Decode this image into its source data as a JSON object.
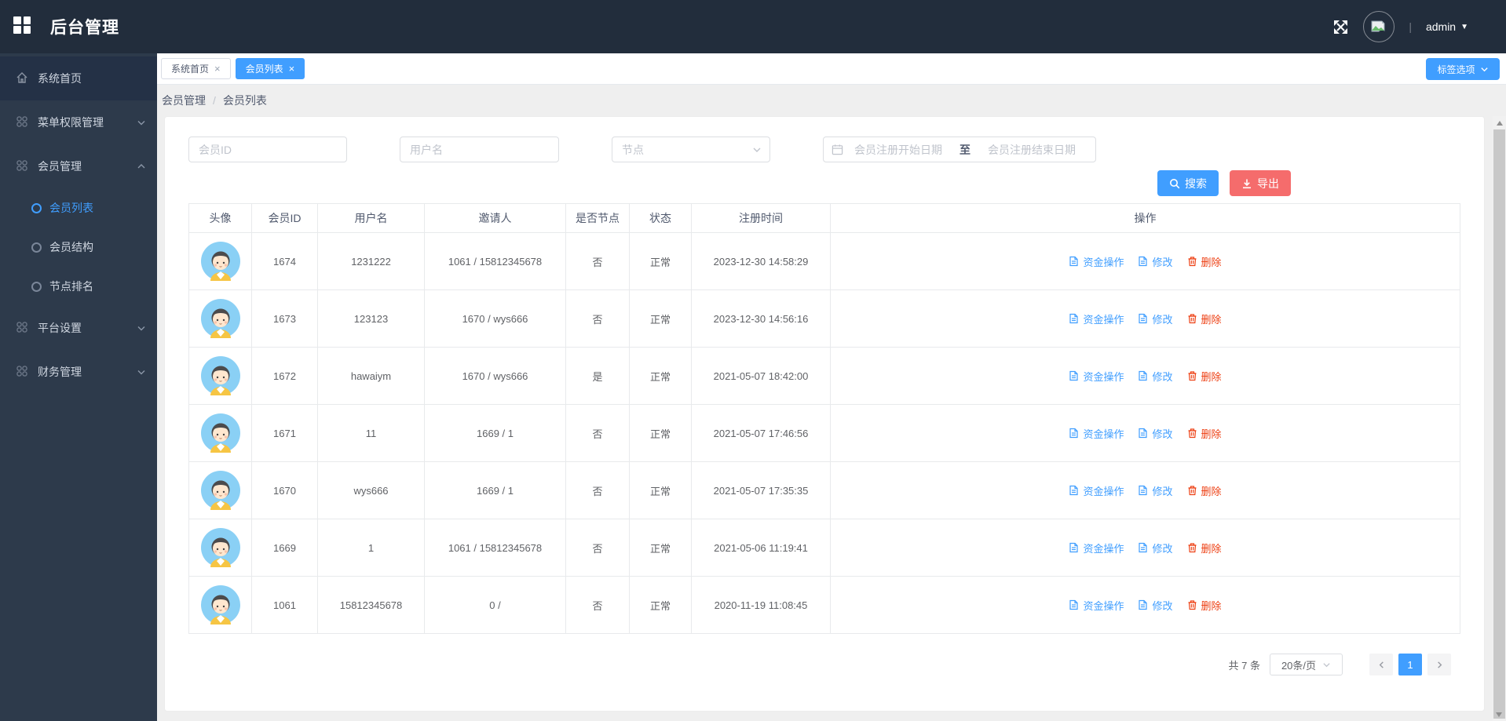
{
  "app": {
    "title": "后台管理",
    "user": "admin"
  },
  "sidebar": {
    "items": [
      {
        "label": "系统首页"
      },
      {
        "label": "菜单权限管理"
      },
      {
        "label": "会员管理"
      },
      {
        "label": "会员列表"
      },
      {
        "label": "会员结构"
      },
      {
        "label": "节点排名"
      },
      {
        "label": "平台设置"
      },
      {
        "label": "财务管理"
      }
    ]
  },
  "tabs": [
    {
      "label": "系统首页"
    },
    {
      "label": "会员列表"
    }
  ],
  "tab_options_label": "标签选项",
  "breadcrumb": {
    "parent": "会员管理",
    "sep": "/",
    "current": "会员列表"
  },
  "filters": {
    "member_id_placeholder": "会员ID",
    "username_placeholder": "用户名",
    "node_placeholder": "节点",
    "date_start_placeholder": "会员注册开始日期",
    "date_to": "至",
    "date_end_placeholder": "会员注册结束日期",
    "search_label": "搜索",
    "export_label": "导出"
  },
  "table": {
    "headers": [
      "头像",
      "会员ID",
      "用户名",
      "邀请人",
      "是否节点",
      "状态",
      "注册时间",
      "操作"
    ],
    "actions": [
      "资金操作",
      "修改",
      "删除"
    ],
    "rows": [
      {
        "id": "1674",
        "username": "1231222",
        "inviter": "1061 / 15812345678",
        "is_node": "否",
        "status": "正常",
        "reg_time": "2023-12-30 14:58:29"
      },
      {
        "id": "1673",
        "username": "123123",
        "inviter": "1670 / wys666",
        "is_node": "否",
        "status": "正常",
        "reg_time": "2023-12-30 14:56:16"
      },
      {
        "id": "1672",
        "username": "hawaiym",
        "inviter": "1670 / wys666",
        "is_node": "是",
        "status": "正常",
        "reg_time": "2021-05-07 18:42:00"
      },
      {
        "id": "1671",
        "username": "11",
        "inviter": "1669 / 1",
        "is_node": "否",
        "status": "正常",
        "reg_time": "2021-05-07 17:46:56"
      },
      {
        "id": "1670",
        "username": "wys666",
        "inviter": "1669 / 1",
        "is_node": "否",
        "status": "正常",
        "reg_time": "2021-05-07 17:35:35"
      },
      {
        "id": "1669",
        "username": "1",
        "inviter": "1061 / 15812345678",
        "is_node": "否",
        "status": "正常",
        "reg_time": "2021-05-06 11:19:41"
      },
      {
        "id": "1061",
        "username": "15812345678",
        "inviter": "0 /",
        "is_node": "否",
        "status": "正常",
        "reg_time": "2020-11-19 11:08:45"
      }
    ]
  },
  "pagination": {
    "total": "共 7 条",
    "page_size": "20条/页",
    "current_page": "1"
  },
  "colors": {
    "primary": "#409eff",
    "export_red": "#f56c6c",
    "delete_red": "#ed4014",
    "topbar_bg": "#222d3c",
    "sidebar_bg": "#2d3a4b",
    "sidebar_active_bg": "#243146",
    "content_bg": "#efefef",
    "table_border": "#e8eaec"
  }
}
